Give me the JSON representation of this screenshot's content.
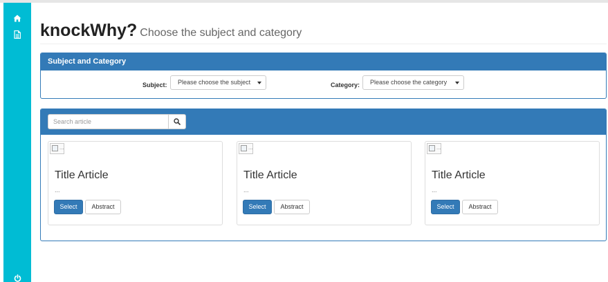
{
  "sidebar": {
    "items": [
      {
        "icon": "home-icon"
      },
      {
        "icon": "document-icon"
      }
    ],
    "footer_icon": "power-icon",
    "color": "#00bcd4"
  },
  "header": {
    "title": "knockWhy?",
    "subtitle": "Choose the subject and category"
  },
  "filters_panel": {
    "heading": "Subject and Category",
    "subject": {
      "label": "Subject:",
      "selected": "Please choose the subject"
    },
    "category": {
      "label": "Category:",
      "selected": "Please choose the category"
    }
  },
  "articles_panel": {
    "search": {
      "placeholder": "Search article",
      "value": ""
    },
    "cards": [
      {
        "image_alt": "...",
        "title": "Title Article",
        "description": "...",
        "select_label": "Select",
        "abstract_label": "Abstract"
      },
      {
        "image_alt": "...",
        "title": "Title Article",
        "description": "...",
        "select_label": "Select",
        "abstract_label": "Abstract"
      },
      {
        "image_alt": "...",
        "title": "Title Article",
        "description": "...",
        "select_label": "Select",
        "abstract_label": "Abstract"
      }
    ]
  },
  "colors": {
    "primary": "#337ab7",
    "sidebar": "#00bcd4"
  }
}
